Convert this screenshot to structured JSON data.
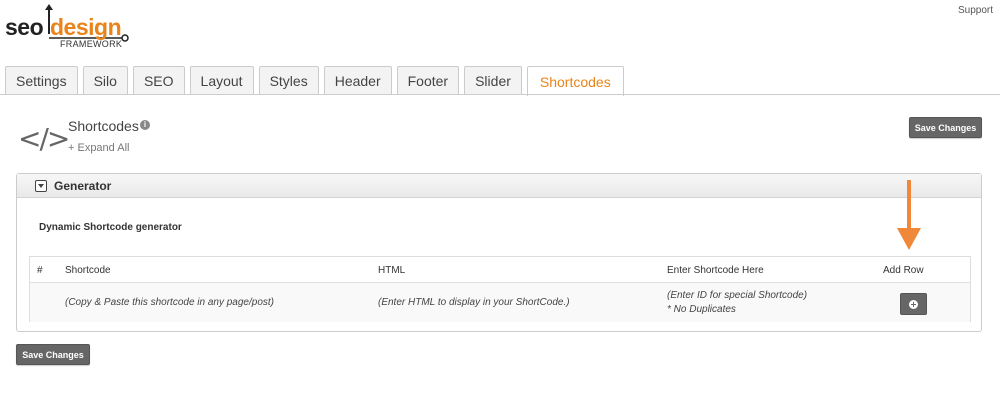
{
  "logo": {
    "seo": "seo",
    "design": "design",
    "framework": "FRAMEWORK"
  },
  "header": {
    "support_link": "Support"
  },
  "tabs": [
    {
      "label": "Settings"
    },
    {
      "label": "Silo"
    },
    {
      "label": "SEO"
    },
    {
      "label": "Layout"
    },
    {
      "label": "Styles"
    },
    {
      "label": "Header"
    },
    {
      "label": "Footer"
    },
    {
      "label": "Slider"
    },
    {
      "label": "Shortcodes",
      "active": true
    }
  ],
  "page": {
    "icon": "</>",
    "title": "Shortcodes",
    "expand_all": "+ Expand All",
    "save_label": "Save Changes"
  },
  "panel": {
    "title": "Generator",
    "subtitle": "Dynamic Shortcode generator",
    "columns": [
      "#",
      "Shortcode",
      "HTML",
      "Enter Shortcode Here",
      "Add Row"
    ],
    "row": {
      "shortcode": "(Copy & Paste this shortcode in any page/post)",
      "html": "(Enter HTML to display in your ShortCode.)",
      "enter_line1": "(Enter ID for special Shortcode)",
      "enter_line2": "* No Duplicates"
    }
  },
  "colors": {
    "accent": "#e8841a",
    "button": "#666666"
  }
}
